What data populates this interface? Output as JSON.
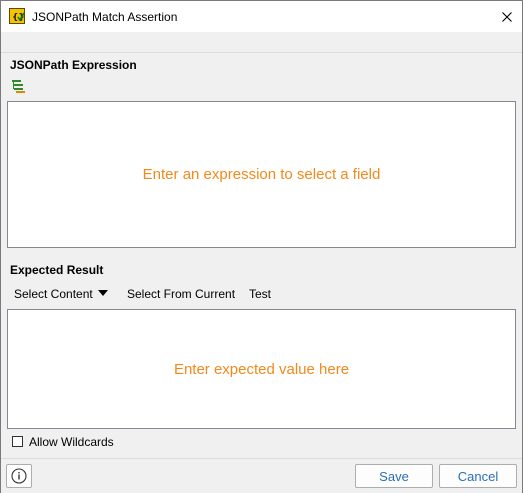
{
  "window": {
    "title": "JSONPath Match Assertion",
    "app_icon": "jsonpath-assertion-icon",
    "close_icon": "close-icon"
  },
  "expression": {
    "label": "JSONPath Expression",
    "tree_icon": "tree-select-icon",
    "placeholder": "Enter an expression to select a field"
  },
  "expected": {
    "label": "Expected Result",
    "toolbar": {
      "select_content": "Select Content",
      "select_from_current": "Select From Current",
      "test": "Test"
    },
    "placeholder": "Enter expected value here"
  },
  "options": {
    "allow_wildcards": "Allow Wildcards",
    "allow_wildcards_checked": false
  },
  "footer": {
    "info_icon": "info-icon",
    "save": "Save",
    "cancel": "Cancel"
  },
  "colors": {
    "placeholder": "#f28a1b",
    "button_text": "#2a6fb6"
  }
}
